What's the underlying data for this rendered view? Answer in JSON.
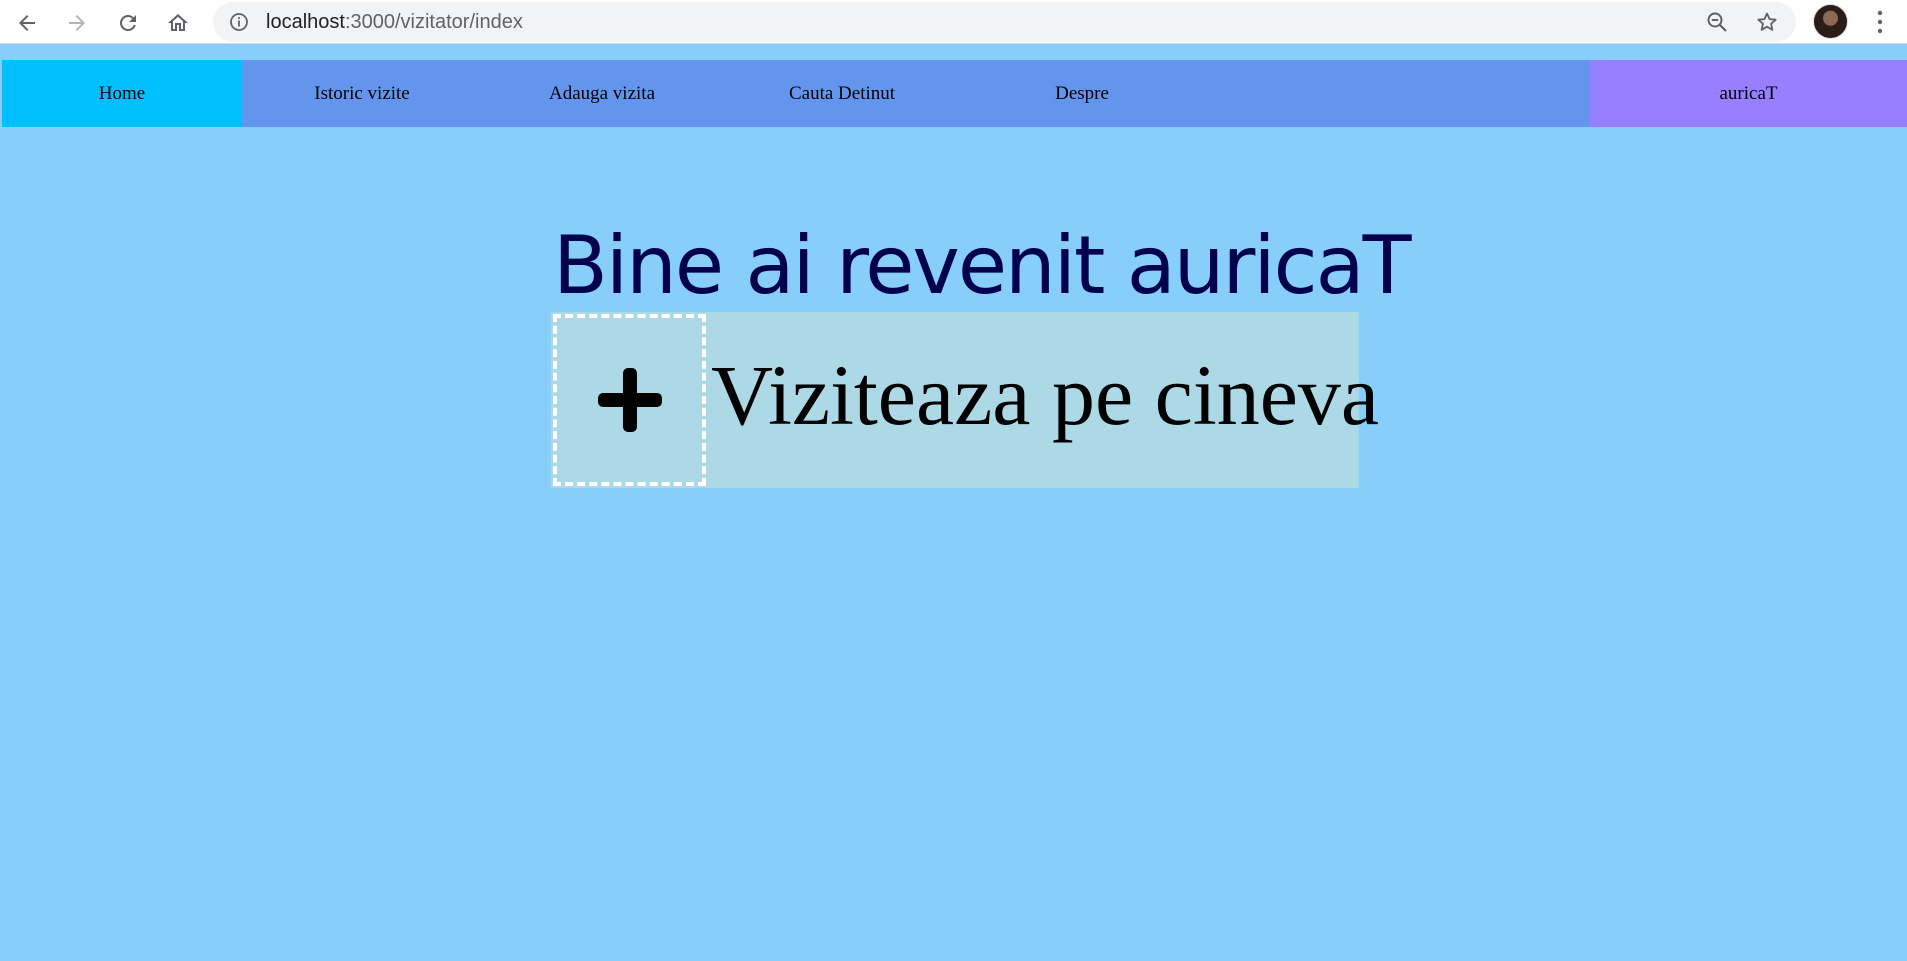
{
  "browser": {
    "url_host": "localhost",
    "url_path": ":3000/vizitator/index"
  },
  "nav": {
    "items": [
      {
        "label": "Home",
        "active": true
      },
      {
        "label": "Istoric vizite",
        "active": false
      },
      {
        "label": "Adauga vizita",
        "active": false
      },
      {
        "label": "Cauta Detinut",
        "active": false
      },
      {
        "label": "Despre",
        "active": false
      }
    ],
    "user": "auricaT"
  },
  "main": {
    "welcome": "Bine ai revenit auricaT",
    "visit_button_label": "Viziteaza pe cineva"
  },
  "colors": {
    "page_bg": "#87cefa",
    "nav_bg": "#6495ed",
    "nav_active": "#00bfff",
    "user_bg": "#9680ff",
    "card_bg": "#add8e6",
    "welcome_text": "#00004d"
  }
}
